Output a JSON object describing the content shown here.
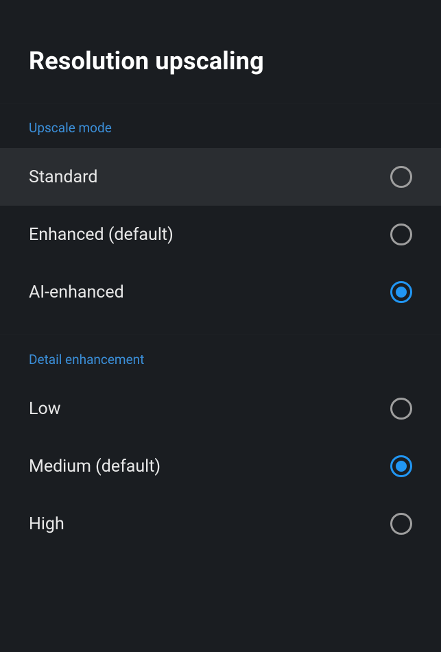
{
  "page": {
    "title": "Resolution upscaling"
  },
  "sections": [
    {
      "header": "Upscale mode",
      "options": [
        {
          "label": "Standard",
          "selected": false,
          "highlighted": true
        },
        {
          "label": "Enhanced (default)",
          "selected": false,
          "highlighted": false
        },
        {
          "label": "AI-enhanced",
          "selected": true,
          "highlighted": false
        }
      ]
    },
    {
      "header": "Detail enhancement",
      "options": [
        {
          "label": "Low",
          "selected": false,
          "highlighted": false
        },
        {
          "label": "Medium (default)",
          "selected": true,
          "highlighted": false
        },
        {
          "label": "High",
          "selected": false,
          "highlighted": false
        }
      ]
    }
  ]
}
